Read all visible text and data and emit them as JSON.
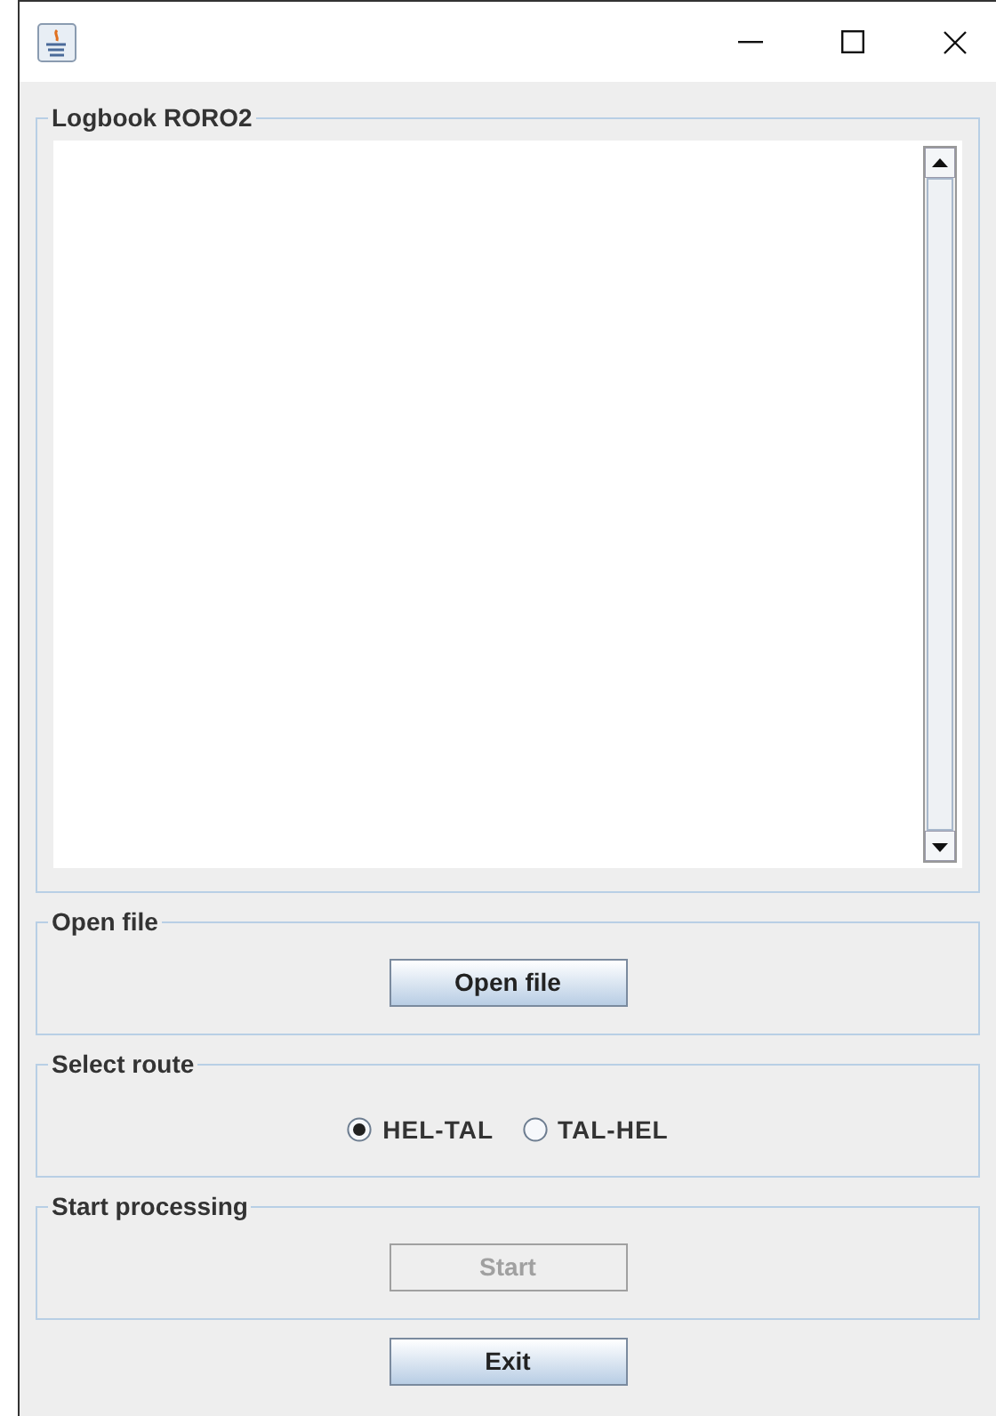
{
  "logbook": {
    "title": "Logbook RORO2"
  },
  "open_file": {
    "title": "Open file",
    "button": {
      "label": "Open file",
      "disabled": false
    }
  },
  "select_route": {
    "title": "Select route",
    "options": [
      {
        "label": "HEL-TAL",
        "selected": true
      },
      {
        "label": "TAL-HEL",
        "selected": false
      }
    ]
  },
  "start_processing": {
    "title": "Start processing",
    "button": {
      "label": "Start",
      "disabled": true
    }
  },
  "exit_button": {
    "label": "Exit",
    "disabled": false
  }
}
